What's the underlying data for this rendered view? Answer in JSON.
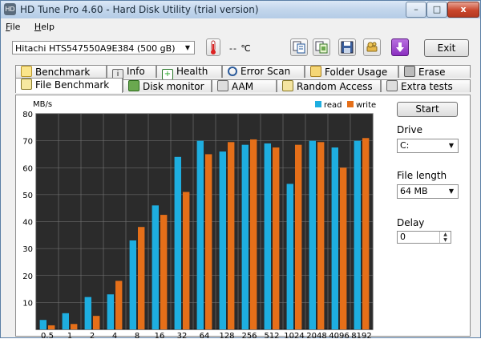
{
  "window": {
    "title": "HD Tune Pro 4.60 - Hard Disk Utility (trial version)",
    "app_icon": "hdd-icon",
    "controls": {
      "minimize": "–",
      "maximize": "□",
      "close": "x"
    }
  },
  "menu": {
    "file": {
      "accel": "F",
      "rest": "ile"
    },
    "help": {
      "accel": "H",
      "rest": "elp"
    }
  },
  "toolbar": {
    "drive": "Hitachi HTS547550A9E384 (500 gB)",
    "temperature": "-- ℃",
    "icons": [
      "copy-text-icon",
      "copy-screen-icon",
      "save-icon",
      "options-icon",
      "download-icon"
    ],
    "exit_label": "Exit"
  },
  "tabs_top": [
    "Benchmark",
    "Info",
    "Health",
    "Error Scan",
    "Folder Usage",
    "Erase"
  ],
  "tabs_bottom": [
    "File Benchmark",
    "Disk monitor",
    "AAM",
    "Random Access",
    "Extra tests"
  ],
  "active_tab": "File Benchmark",
  "side_panel": {
    "start_label": "Start",
    "drive_label": "Drive",
    "drive_value": "C:",
    "file_length_label": "File length",
    "file_length_value": "64 MB",
    "delay_label": "Delay",
    "delay_value": "0"
  },
  "colors": {
    "read": "#1eaee0",
    "write": "#e56f19",
    "plot_bg": "#2b2b2b",
    "grid": "#787878"
  },
  "chart_data": {
    "type": "bar",
    "ylabel": "MB/s",
    "ylim": [
      0,
      80
    ],
    "yticks": [
      10,
      20,
      30,
      40,
      50,
      60,
      70,
      80
    ],
    "categories": [
      "0.5",
      "1",
      "2",
      "4",
      "8",
      "16",
      "32",
      "64",
      "128",
      "256",
      "512",
      "1024",
      "2048",
      "4096",
      "8192"
    ],
    "series": [
      {
        "name": "read",
        "values": [
          3.5,
          6,
          12,
          13,
          33,
          46,
          64,
          70,
          66,
          68.5,
          69,
          54,
          70,
          67.5,
          70
        ]
      },
      {
        "name": "write",
        "values": [
          1.5,
          2,
          5,
          18,
          38,
          42.5,
          51,
          65,
          69.5,
          70.5,
          67.5,
          68.5,
          69.5,
          60,
          71
        ]
      }
    ],
    "legend_position": "top-right",
    "grid": true
  }
}
